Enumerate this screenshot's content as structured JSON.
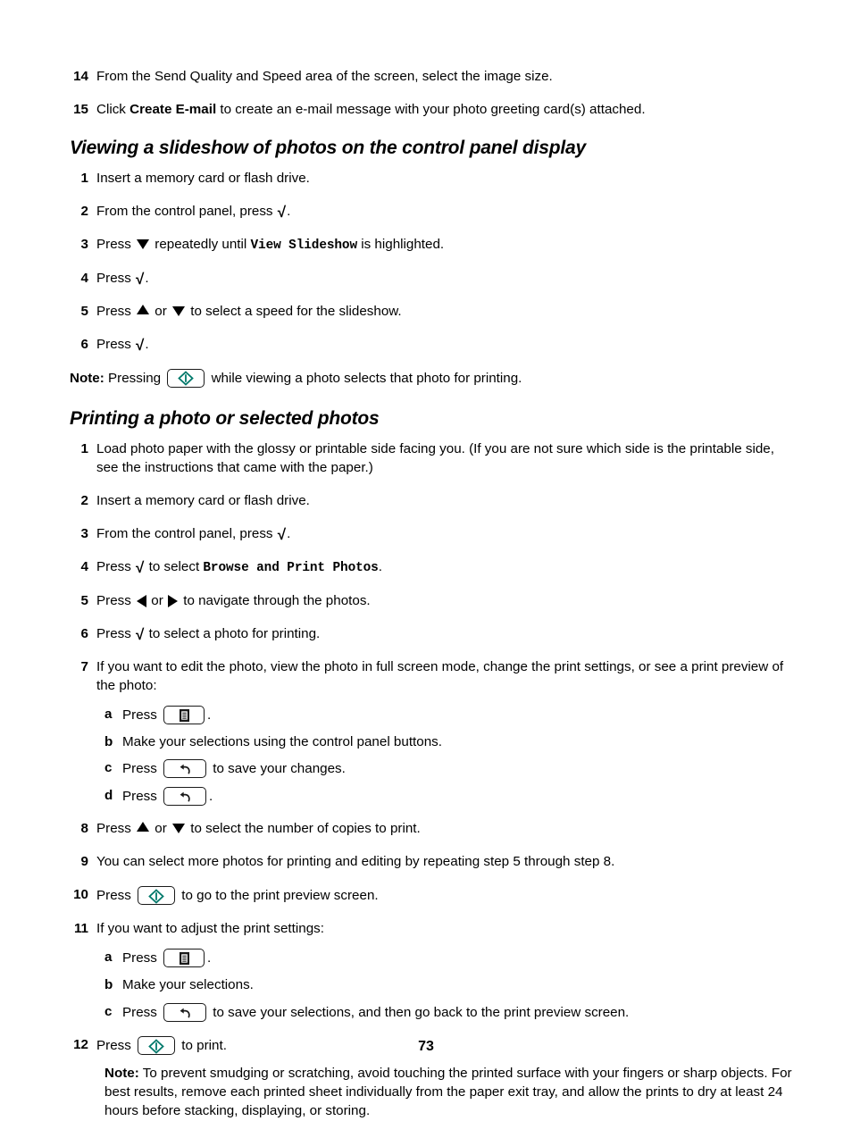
{
  "document": {
    "page_number": "73",
    "accent_color": "#00796b",
    "text_color": "#000000",
    "background_color": "#ffffff"
  },
  "intro_steps": [
    {
      "num": "14",
      "text": "From the Send Quality and Speed area of the screen, select the image size."
    },
    {
      "num": "15",
      "prefix": "Click ",
      "bold": "Create E-mail",
      "suffix": " to create an e-mail message with your photo greeting card(s) attached."
    }
  ],
  "section_slideshow": {
    "heading": "Viewing a slideshow of photos on the control panel display",
    "steps": [
      {
        "num": "1",
        "text": "Insert a memory card or flash drive."
      },
      {
        "num": "2",
        "prefix": "From the control panel, press ",
        "glyph": "check",
        "suffix": "."
      },
      {
        "num": "3",
        "prefix": "Press ",
        "glyph": "down-arrow",
        "mid": " repeatedly until ",
        "mono": "View Slideshow",
        "suffix": " is highlighted."
      },
      {
        "num": "4",
        "prefix": "Press ",
        "glyph": "check",
        "suffix": "."
      },
      {
        "num": "5",
        "prefix": "Press ",
        "glyph": "up-arrow",
        "mid": " or ",
        "glyph2": "down-arrow",
        "suffix": " to select a speed for the slideshow."
      },
      {
        "num": "6",
        "prefix": "Press ",
        "glyph": "check",
        "suffix": "."
      }
    ],
    "note": {
      "label": "Note:",
      "prefix": " Pressing ",
      "key": "start-button",
      "suffix": " while viewing a photo selects that photo for printing."
    }
  },
  "section_printing": {
    "heading": "Printing a photo or selected photos",
    "steps": [
      {
        "num": "1",
        "text": "Load photo paper with the glossy or printable side facing you. (If you are not sure which side is the printable side, see the instructions that came with the paper.)"
      },
      {
        "num": "2",
        "text": "Insert a memory card or flash drive."
      },
      {
        "num": "3",
        "prefix": "From the control panel, press ",
        "glyph": "check",
        "suffix": "."
      },
      {
        "num": "4",
        "prefix": "Press ",
        "glyph": "check",
        "mid": " to select ",
        "mono": "Browse and Print Photos",
        "suffix": "."
      },
      {
        "num": "5",
        "prefix": "Press ",
        "glyph": "left-arrow",
        "mid": " or ",
        "glyph2": "right-arrow",
        "suffix": " to navigate through the photos."
      },
      {
        "num": "6",
        "prefix": "Press ",
        "glyph": "check",
        "suffix": " to select a photo for printing."
      },
      {
        "num": "7",
        "text": "If you want to edit the photo, view the photo in full screen mode, change the print settings, or see a print preview of the photo:"
      }
    ],
    "substeps_7": [
      {
        "letter": "a",
        "prefix": "Press ",
        "key": "menu-button",
        "suffix": "."
      },
      {
        "letter": "b",
        "text": "Make your selections using the control panel buttons."
      },
      {
        "letter": "c",
        "prefix": "Press ",
        "key": "back-button",
        "suffix": " to save your changes."
      },
      {
        "letter": "d",
        "prefix": "Press ",
        "key": "back-button",
        "suffix": "."
      }
    ],
    "steps_cont": [
      {
        "num": "8",
        "prefix": "Press ",
        "glyph": "up-arrow",
        "mid": " or ",
        "glyph2": "down-arrow",
        "suffix": " to select the number of copies to print."
      },
      {
        "num": "9",
        "text": "You can select more photos for printing and editing by repeating step 5 through step 8."
      },
      {
        "num": "10",
        "prefix": "Press ",
        "key": "start-button",
        "suffix": " to go to the print preview screen."
      },
      {
        "num": "11",
        "text": "If you want to adjust the print settings:"
      }
    ],
    "substeps_11": [
      {
        "letter": "a",
        "prefix": "Press ",
        "key": "menu-button",
        "suffix": "."
      },
      {
        "letter": "b",
        "text": "Make your selections."
      },
      {
        "letter": "c",
        "prefix": "Press ",
        "key": "back-button",
        "suffix": " to save your selections, and then go back to the print preview screen."
      }
    ],
    "step_12": {
      "num": "12",
      "prefix": "Press ",
      "key": "start-button",
      "suffix": " to print."
    },
    "final_note": {
      "label": "Note:",
      "text": " To prevent smudging or scratching, avoid touching the printed surface with your fingers or sharp objects. For best results, remove each printed sheet individually from the paper exit tray, and allow the prints to dry at least 24 hours before stacking, displaying, or storing."
    }
  },
  "glyphs": {
    "check": "√",
    "down_arrow": "▼",
    "up_arrow": "▲",
    "left_arrow": "◀",
    "right_arrow": "▶"
  }
}
